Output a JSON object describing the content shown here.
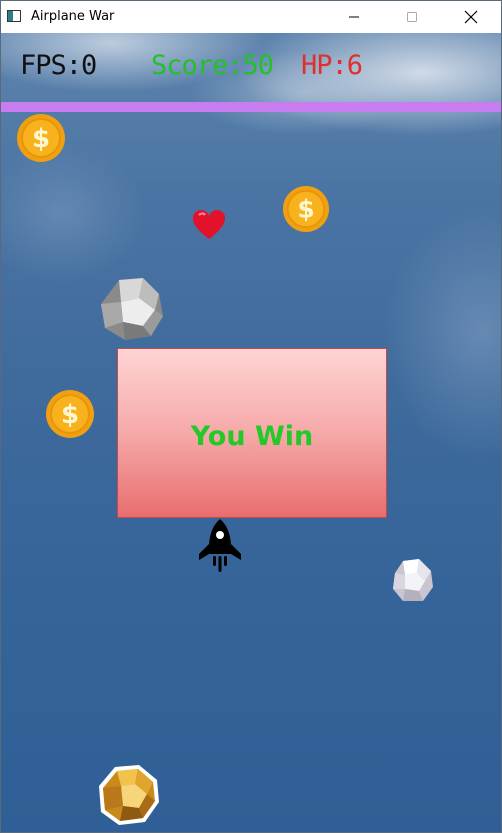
{
  "window": {
    "title": "Airplane War",
    "minimize_symbol": "—",
    "maximize_symbol": "☐",
    "close_symbol": "✕"
  },
  "hud": {
    "fps": "FPS:0",
    "score": "Score:50",
    "hp": "HP:6"
  },
  "dialog": {
    "message": "You Win"
  },
  "colors": {
    "fps": "#111111",
    "score": "#22c12a",
    "hp": "#e0302e",
    "top_bar": "#c77cf0",
    "dialog_text": "#22c928"
  },
  "sprites": [
    "coin-icon",
    "coin-icon",
    "coin-icon",
    "heart-icon",
    "rock-icon",
    "rock-icon",
    "rocket-icon",
    "gold-rock-icon"
  ]
}
